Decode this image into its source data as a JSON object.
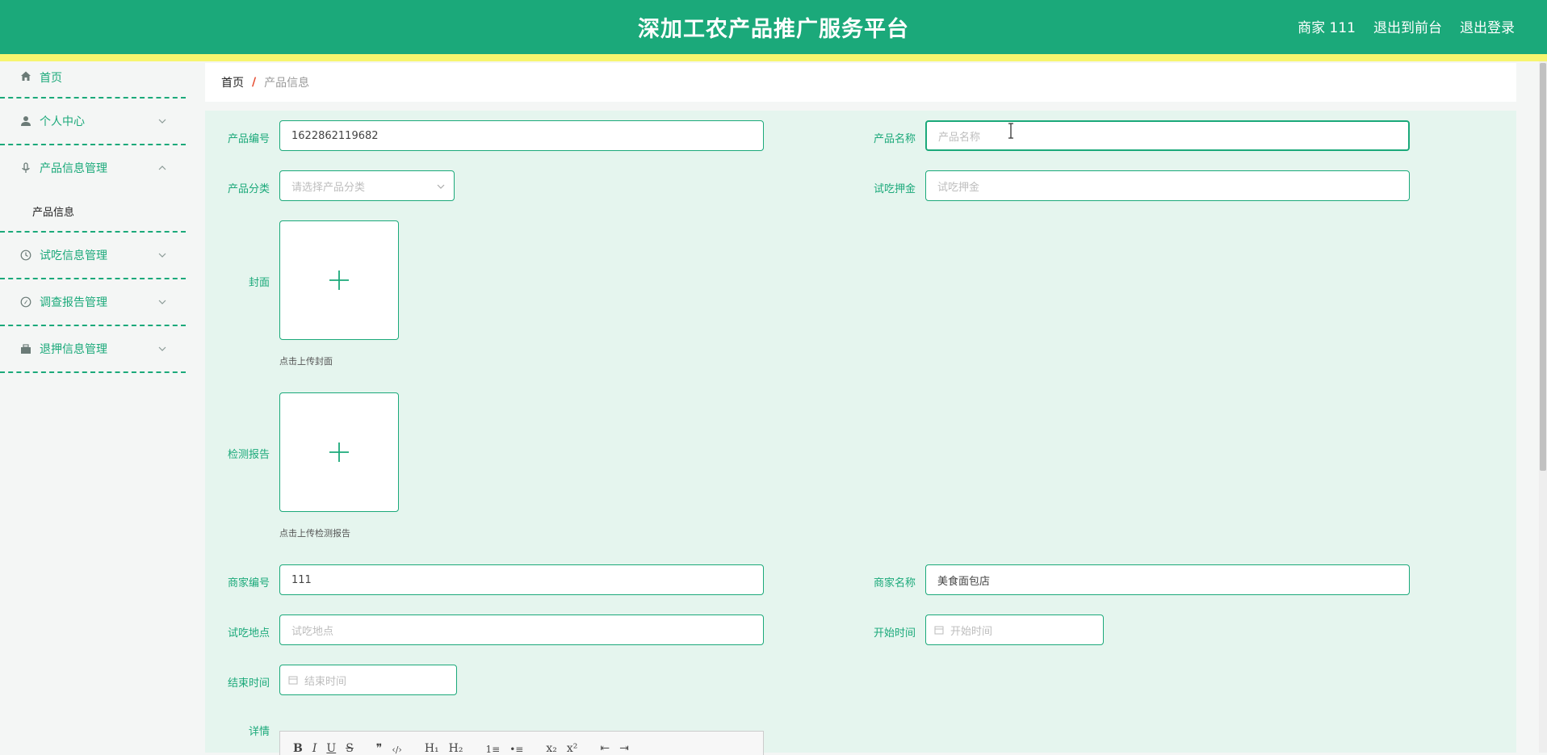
{
  "header": {
    "title": "深加工农产品推广服务平台",
    "user_label": "商家 111",
    "front_link": "退出到前台",
    "logout_link": "退出登录"
  },
  "sidebar": {
    "items": [
      {
        "label": "首页",
        "icon": "home-icon"
      },
      {
        "label": "个人中心",
        "icon": "user-icon"
      },
      {
        "label": "产品信息管理",
        "icon": "mic-icon",
        "expanded": true,
        "children": [
          "产品信息"
        ]
      },
      {
        "label": "试吃信息管理",
        "icon": "clock-icon"
      },
      {
        "label": "调查报告管理",
        "icon": "compass-icon"
      },
      {
        "label": "退押信息管理",
        "icon": "briefcase-icon"
      }
    ]
  },
  "breadcrumb": {
    "home": "首页",
    "sep": "/",
    "current": "产品信息"
  },
  "form": {
    "product_no": {
      "label": "产品编号",
      "value": "1622862119682"
    },
    "product_name": {
      "label": "产品名称",
      "placeholder": "产品名称"
    },
    "category": {
      "label": "产品分类",
      "placeholder": "请选择产品分类"
    },
    "deposit": {
      "label": "试吃押金",
      "placeholder": "试吃押金"
    },
    "cover": {
      "label": "封面",
      "hint": "点击上传封面"
    },
    "report": {
      "label": "检测报告",
      "hint": "点击上传检测报告"
    },
    "merchant_no": {
      "label": "商家编号",
      "value": "111"
    },
    "merchant_name": {
      "label": "商家名称",
      "value": "美食面包店"
    },
    "location": {
      "label": "试吃地点",
      "placeholder": "试吃地点"
    },
    "start_time": {
      "label": "开始时间",
      "placeholder": "开始时间"
    },
    "end_time": {
      "label": "结束时间",
      "placeholder": "结束时间"
    },
    "detail": {
      "label": "详情"
    }
  },
  "editor_toolbar": [
    "B",
    "I",
    "U",
    "S",
    "❞",
    "‹/›",
    "H₁",
    "H₂",
    "1≡",
    "•≡",
    "x₂",
    "x²",
    "⇤",
    "⇥"
  ],
  "colors": {
    "primary": "#1ba97a",
    "strip": "#f7f56f",
    "panel": "#e5f5ee"
  }
}
